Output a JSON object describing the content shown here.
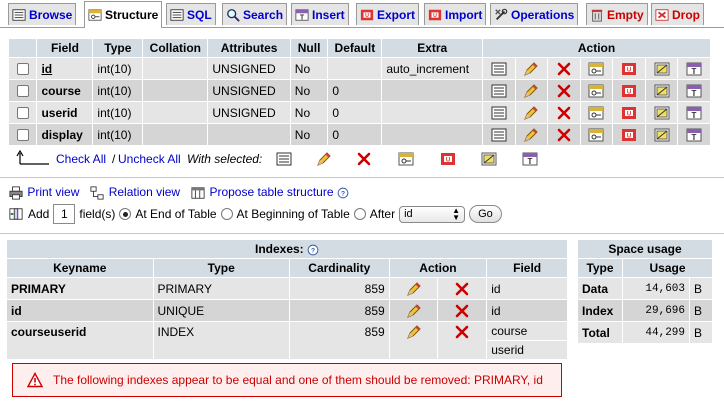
{
  "tabs": [
    {
      "label": "Browse",
      "icon": "browse-icon",
      "active": false
    },
    {
      "label": "Structure",
      "icon": "structure-icon",
      "active": true
    },
    {
      "label": "SQL",
      "icon": "sql-icon",
      "active": false
    },
    {
      "label": "Search",
      "icon": "search-icon",
      "active": false
    },
    {
      "label": "Insert",
      "icon": "insert-icon",
      "active": false
    },
    {
      "label": "Export",
      "icon": "export-icon",
      "active": false
    },
    {
      "label": "Import",
      "icon": "import-icon",
      "active": false
    },
    {
      "label": "Operations",
      "icon": "operations-icon",
      "active": false
    },
    {
      "label": "Empty",
      "icon": "empty-icon",
      "active": false
    },
    {
      "label": "Drop",
      "icon": "drop-icon",
      "active": false
    }
  ],
  "structure": {
    "headers": {
      "field": "Field",
      "type": "Type",
      "collation": "Collation",
      "attributes": "Attributes",
      "null": "Null",
      "default": "Default",
      "extra": "Extra",
      "action": "Action"
    },
    "rows": [
      {
        "field": "id",
        "type": "int(10)",
        "collation": "",
        "attributes": "UNSIGNED",
        "null": "No",
        "default": "",
        "extra": "auto_increment"
      },
      {
        "field": "course",
        "type": "int(10)",
        "collation": "",
        "attributes": "UNSIGNED",
        "null": "No",
        "default": "0",
        "extra": ""
      },
      {
        "field": "userid",
        "type": "int(10)",
        "collation": "",
        "attributes": "UNSIGNED",
        "null": "No",
        "default": "0",
        "extra": ""
      },
      {
        "field": "display",
        "type": "int(10)",
        "collation": "",
        "attributes": "",
        "null": "No",
        "default": "0",
        "extra": ""
      }
    ]
  },
  "selection": {
    "check_all": "Check All",
    "separator": "/",
    "uncheck_all": "Uncheck All",
    "with_selected": "With selected:"
  },
  "tools": {
    "print_view": "Print view",
    "relation_view": "Relation view",
    "propose": "Propose table structure"
  },
  "add": {
    "label": "Add",
    "count": "1",
    "fields_label": "field(s)",
    "opt_end": "At End of Table",
    "opt_begin": "At Beginning of Table",
    "opt_after": "After",
    "after_value": "id",
    "go": "Go"
  },
  "indexes": {
    "title": "Indexes:",
    "headers": {
      "keyname": "Keyname",
      "type": "Type",
      "cardinality": "Cardinality",
      "action": "Action",
      "field": "Field"
    },
    "rows": [
      {
        "keyname": "PRIMARY",
        "type": "PRIMARY",
        "cardinality": "859",
        "fields": [
          "id"
        ]
      },
      {
        "keyname": "id",
        "type": "UNIQUE",
        "cardinality": "859",
        "fields": [
          "id"
        ]
      },
      {
        "keyname": "courseuserid",
        "type": "INDEX",
        "cardinality": "859",
        "fields": [
          "course",
          "userid"
        ]
      }
    ]
  },
  "space": {
    "title": "Space usage",
    "headers": {
      "type": "Type",
      "usage": "Usage"
    },
    "rows": [
      {
        "type": "Data",
        "value": "14,603",
        "unit": "B"
      },
      {
        "type": "Index",
        "value": "29,696",
        "unit": "B"
      },
      {
        "type": "Total",
        "value": "44,299",
        "unit": "B"
      }
    ]
  },
  "warning": {
    "text": "The following indexes appear to be equal and one of them should be removed: PRIMARY, id"
  },
  "colors": {
    "header_bg": "#d3dce3",
    "row_odd": "#e5e5e5",
    "row_even": "#d5d5d5",
    "link": "#0000cc",
    "danger": "#cc0000"
  }
}
